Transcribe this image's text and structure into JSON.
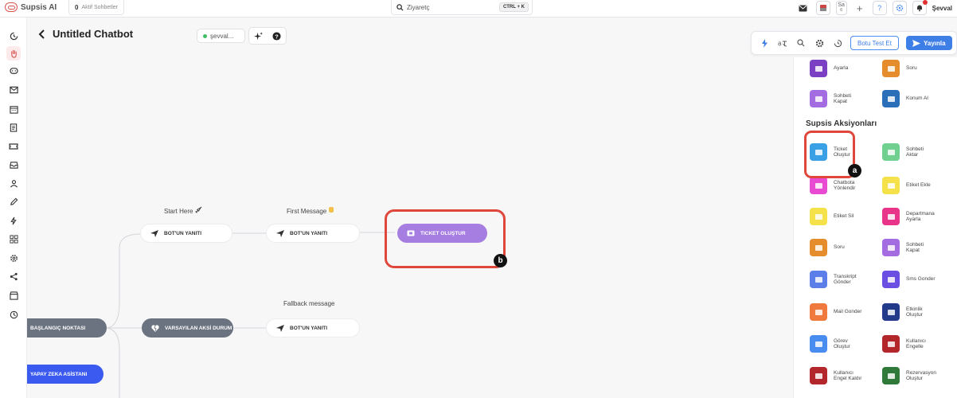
{
  "app": {
    "brand": "Supsis AI",
    "active_chats_count": "0",
    "active_chats_label": "Aktif Sohbetler",
    "search_value": "Ziyaretç",
    "search_shortcut": "CTRL + K",
    "top_icons": [
      "mail-icon",
      "flag-icon",
      "sa-language",
      "plus-icon",
      "help-icon",
      "settings-icon",
      "notification-icon"
    ],
    "lang_label": "Sa",
    "lang_sub": "6",
    "user_name": "Şevval",
    "accent_color": "#3d7fe6",
    "brand_color": "#d9534f"
  },
  "sidebar": {
    "items": [
      {
        "icon": "history-icon"
      },
      {
        "icon": "hand-icon",
        "active": true
      },
      {
        "icon": "chat-icon"
      },
      {
        "icon": "mail-icon"
      },
      {
        "icon": "calendar-icon"
      },
      {
        "icon": "document-icon"
      },
      {
        "icon": "ticket-icon"
      },
      {
        "icon": "archive-icon"
      },
      {
        "icon": "users-icon"
      },
      {
        "icon": "edit-icon"
      },
      {
        "icon": "flash-icon"
      },
      {
        "icon": "apps-icon"
      },
      {
        "icon": "gear-icon"
      },
      {
        "icon": "share-icon"
      },
      {
        "icon": "store-icon"
      },
      {
        "icon": "clock-icon"
      }
    ]
  },
  "header": {
    "title": "Untitled Chatbot",
    "status_label": "şevval..."
  },
  "toolbar": {
    "test_label": "Botu Test Et",
    "publish_label": "Yayınla"
  },
  "canvas": {
    "start_here": "Start Here",
    "first_message": "First Message",
    "fallback_message": "Fallback message",
    "bot_reply_1": "BOT'UN YANITI",
    "bot_reply_2": "BOT'UN YANITI",
    "bot_reply_3": "BOT'UN YANITI",
    "ticket_node": "TICKET OLUŞTUR",
    "start_point": "BAŞLANGIÇ NOKTASI",
    "default_answer": "VARSAYILAN AKSİ DURUM",
    "ai_assistant": "YAPAY ZEKA ASİSTANI"
  },
  "panel": {
    "section_title": "Supsis Aksiyonları",
    "top_items": [
      {
        "label": "Ayarla",
        "color": "#7b3fc4"
      },
      {
        "label": "Soru",
        "color": "#e58d2d"
      },
      {
        "label": "Sohbeti\nKapat",
        "color": "#a36ce0"
      },
      {
        "label": "Konum Al",
        "color": "#2b6fb8"
      }
    ],
    "items": [
      {
        "label": "Ticket\nOluştur",
        "color": "#3aa0e6"
      },
      {
        "label": "Sohbeti\nAktar",
        "color": "#6fd08f"
      },
      {
        "label": "Chatbota\nYönlendir",
        "color": "#e84ad2"
      },
      {
        "label": "Etiket Ekle",
        "color": "#f5e14a"
      },
      {
        "label": "Etiket Sil",
        "color": "#f5e14a"
      },
      {
        "label": "Departmana\nAyarla",
        "color": "#e8358a"
      },
      {
        "label": "Soru",
        "color": "#e58d2d"
      },
      {
        "label": "Sohbeti\nKapat",
        "color": "#a36ce0"
      },
      {
        "label": "Transkript\nGönder",
        "color": "#5b7ee8"
      },
      {
        "label": "Sms Gonder",
        "color": "#6b4fe3"
      },
      {
        "label": "Mail Gonder",
        "color": "#f07a3e"
      },
      {
        "label": "Etkinlik\nOluştur",
        "color": "#233a8a"
      },
      {
        "label": "Görev\nOluştur",
        "color": "#4a8df0"
      },
      {
        "label": "Kullanıcı\nEngelle",
        "color": "#b3262b"
      },
      {
        "label": "Kullanıcı\nEngel Kaldır",
        "color": "#b3262b"
      },
      {
        "label": "Rezervasyon\nOluştur",
        "color": "#2f7a3a"
      }
    ]
  },
  "annotations": {
    "a": "a",
    "b": "b"
  }
}
